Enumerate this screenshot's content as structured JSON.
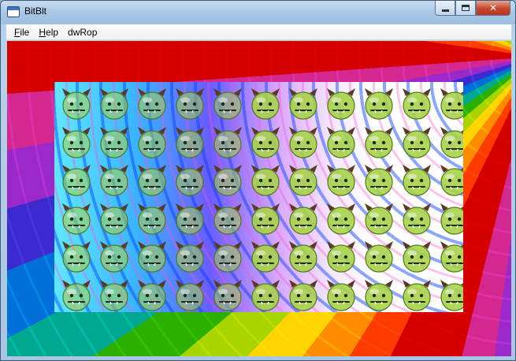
{
  "window": {
    "title": "BitBlt",
    "icon": "app-window-icon",
    "caption_buttons": {
      "minimize": "minimize-icon",
      "maximize": "maximize-icon",
      "close": "✕"
    }
  },
  "menu": {
    "items": [
      {
        "label": "File",
        "accel": "F",
        "rest": "ile"
      },
      {
        "label": "Help",
        "accel": "H",
        "rest": "elp"
      },
      {
        "label": "dwRop",
        "accel": "",
        "rest": "dwRop"
      }
    ]
  },
  "colors": {
    "face_fill": "#a8d34a",
    "horn": "#5a3a20",
    "blit_background": "#ffffff"
  },
  "canvas": {
    "background_icon": "rainbow-spiral-background",
    "sprite_icon": "devil-smiley-icon",
    "grid_columns": 11,
    "grid_rows": 6
  }
}
